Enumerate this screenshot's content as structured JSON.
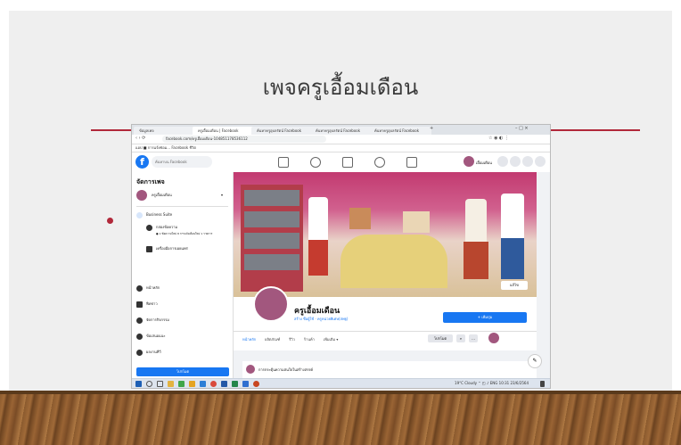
{
  "slide": {
    "title": "เพจครูเอื้อมเดือน"
  },
  "browser": {
    "tabs": [
      {
        "label": "ข้อมูลเพจ"
      },
      {
        "label": "ครูเอื้อมเดือน | Facebook"
      },
      {
        "label": "ค้นหาครูอุบลรัตน์ Facebook"
      },
      {
        "label": "ค้นหาครูอุบลรัตน์ Facebook"
      },
      {
        "label": "ค้นหาครูอุบลรัตน์ Facebook"
      }
    ],
    "new_tab": "+",
    "window_controls": "–  □  ×",
    "url": "facebook.com/ครูเอื้อมเดือน-104851178536112",
    "bookmarks": "แอป   ■ การแจ้งซ่อม...   Facebook   ชีวิต"
  },
  "facebook": {
    "search_placeholder": "ค้นหาบน Facebook",
    "profile_name": "เอื้อมเดือน"
  },
  "sidebar": {
    "title": "จัดการเพจ",
    "page_name": "ครูเอื้อมเดือน",
    "business_suite": "Business Suite",
    "inbox_label": "กล่องข้อความ",
    "inbox_note": "● 1 ข้อความใหม่ 8 การแจ้งเตือนใหม่ 1 รายการ",
    "create_post": "เครื่องมือการเผยแพร่",
    "nav": [
      {
        "label": "หน้าหลัก"
      },
      {
        "label": "ฟีดข่าว"
      },
      {
        "label": "จัดการกิจกรรม"
      },
      {
        "label": "ข้อเสนอแนะ"
      },
      {
        "label": "ผลงานทีวี"
      }
    ],
    "promote_button": "โปรโมต"
  },
  "page": {
    "name": "ครูเอื้อมเดือน",
    "subtitle": "สร้าง ชื่อผู้ใช้ · ครูหน่วยพิเศษ(สพฐ)",
    "cover_button": "แก้ไข",
    "follow_button": "+ เพิ่มปุ่ม",
    "promote_label": "โปรโมต",
    "tabs": [
      {
        "label": "หน้าหลัก"
      },
      {
        "label": "ผลิตภัณฑ์"
      },
      {
        "label": "รีวิว"
      },
      {
        "label": "ร้านค้า"
      },
      {
        "label": "เพิ่มเติม ▾"
      }
    ],
    "post_hint": "การกระตุ้นความสนใจในสร้างสรรค์"
  },
  "taskbar": {
    "weather": "19°C Cloudy",
    "time": "10:31",
    "date": "23/6/2564"
  }
}
